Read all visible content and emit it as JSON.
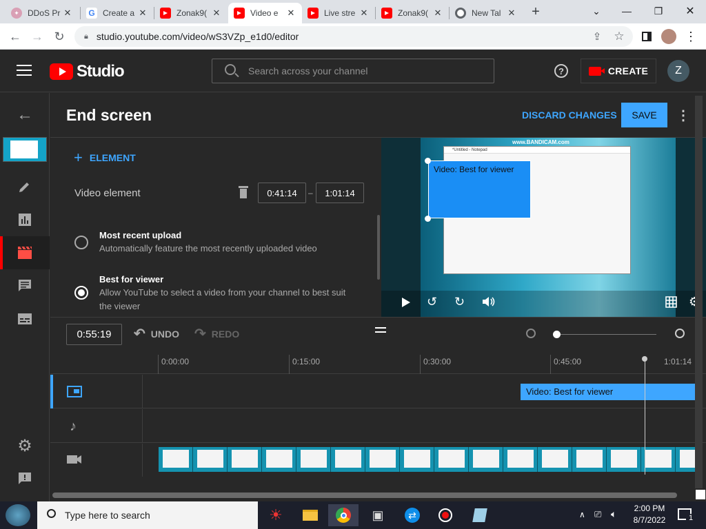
{
  "browser": {
    "tabs": [
      {
        "label": "DDoS Pr",
        "icon": "ddos-favicon",
        "active": false
      },
      {
        "label": "Create a",
        "icon": "google-icon",
        "active": false
      },
      {
        "label": "Zonak9(",
        "icon": "youtube-icon",
        "active": false
      },
      {
        "label": "Video e",
        "icon": "youtube-icon",
        "active": true
      },
      {
        "label": "Live stre",
        "icon": "youtube-icon",
        "active": false
      },
      {
        "label": "Zonak9(",
        "icon": "youtube-icon",
        "active": false
      },
      {
        "label": "New Tal",
        "icon": "chrome-icon",
        "active": false
      }
    ],
    "new_tab": "+",
    "url": "studio.youtube.com/video/wS3VZp_e1d0/editor"
  },
  "header": {
    "logo_text": "Studio",
    "search_placeholder": "Search across your channel",
    "create_label": "CREATE",
    "avatar_letter": "Z"
  },
  "editor": {
    "title": "End screen",
    "discard_label": "DISCARD CHANGES",
    "save_label": "SAVE",
    "add_element_label": "ELEMENT",
    "element_name": "Video element",
    "start_time": "0:41:14",
    "end_time": "1:01:14",
    "time_sep": "–",
    "options": [
      {
        "title": "Most recent upload",
        "desc": "Automatically feature the most recently uploaded video",
        "selected": false
      },
      {
        "title": "Best for viewer",
        "desc1": "Allow YouTube to select a video from your channel to best suit",
        "desc2": "the viewer",
        "selected": true
      }
    ]
  },
  "preview": {
    "overlay_label": "Video: Best for viewer",
    "watermark": "www.BANDICAM.com",
    "notepad_title": "*Untitled - Notepad"
  },
  "timeline": {
    "current_time": "0:55:19",
    "undo_label": "UNDO",
    "redo_label": "REDO",
    "ticks": [
      "0:00:00",
      "0:15:00",
      "0:30:00",
      "0:45:00",
      "1:01:14"
    ],
    "clip_label": "Video: Best for viewer"
  },
  "taskbar": {
    "search_placeholder": "Type here to search",
    "time": "2:00 PM",
    "date": "8/7/2022",
    "notification_count": "1"
  },
  "colors": {
    "accent_blue": "#3ea6ff",
    "red": "#ff0000",
    "bg": "#282828"
  }
}
